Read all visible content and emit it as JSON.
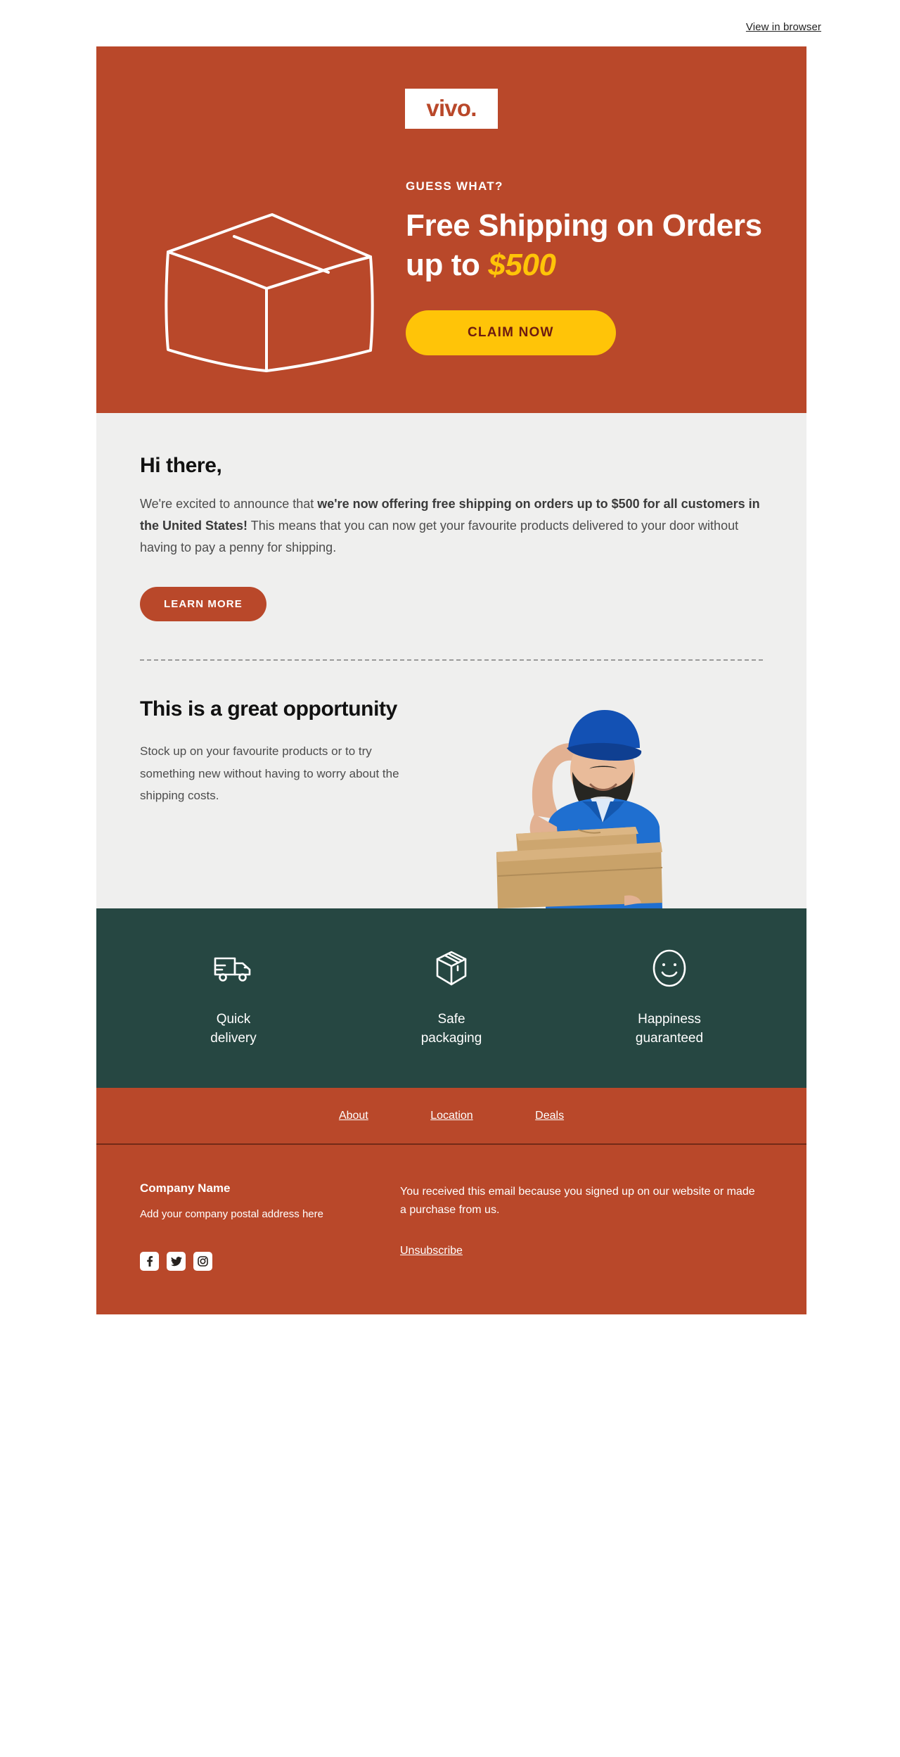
{
  "preheader": {
    "view_in_browser": "View in browser"
  },
  "hero": {
    "logo_text": "vivo.",
    "eyebrow": "GUESS WHAT?",
    "headline_part1": "Free Shipping on Orders up to ",
    "headline_amount": "$500",
    "cta_label": "CLAIM NOW",
    "bg_color": "#b9482a",
    "accent_color": "#ffc408",
    "illustration": "cardboard-box-line-art"
  },
  "intro": {
    "greeting": "Hi there,",
    "body_lead": "We're excited to announce that ",
    "body_bold": "we're now offering free shipping on orders up to $500 for all customers in the United States!",
    "body_tail": " This means that you can now get your favourite products delivered to your door without having to pay a penny for shipping.",
    "cta_label": "LEARN MORE"
  },
  "opportunity": {
    "heading": "This is a great opportunity",
    "body": "Stock up on your favourite products or to try something new without having to worry about the shipping costs.",
    "image_alt": "delivery-man-holding-boxes"
  },
  "features": {
    "bg_color": "#264742",
    "items": [
      {
        "icon": "delivery-truck-icon",
        "label": "Quick\ndelivery"
      },
      {
        "icon": "package-box-icon",
        "label": "Safe\npackaging"
      },
      {
        "icon": "smiley-face-icon",
        "label": "Happiness\nguaranteed"
      }
    ]
  },
  "footer_nav": {
    "links": [
      {
        "label": "About"
      },
      {
        "label": "Location"
      },
      {
        "label": "Deals"
      }
    ]
  },
  "footer": {
    "company_name": "Company Name",
    "company_address": "Add your company postal address here",
    "note": "You received this email because you signed up on our website or made a purchase from us.",
    "unsubscribe": "Unsubscribe",
    "socials": [
      {
        "icon": "facebook-icon"
      },
      {
        "icon": "twitter-icon"
      },
      {
        "icon": "instagram-icon"
      }
    ]
  }
}
